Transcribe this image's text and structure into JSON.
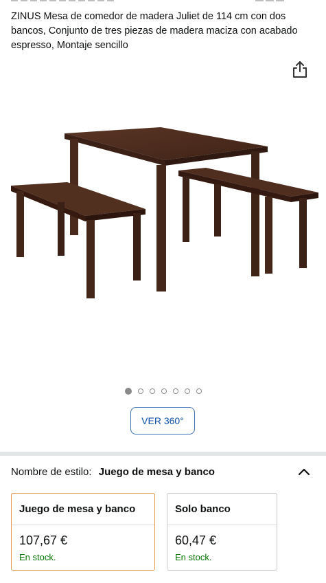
{
  "product": {
    "title": "ZINUS Mesa de comedor de madera Juliet de 114 cm con dos bancos, Conjunto de tres piezas de madera maciza con acabado espresso, Montaje sencillo"
  },
  "icons": {
    "share": "share-icon",
    "chevron": "chevron-up-icon"
  },
  "gallery": {
    "image_count": 7,
    "active_index": 0,
    "view360_label": "VER 360°"
  },
  "style_selector": {
    "label": "Nombre de estilo:",
    "selected_value": "Juego de mesa y banco",
    "options": [
      {
        "name": "Juego de mesa y banco",
        "price": "107,67 €",
        "stock": "En stock.",
        "selected": true
      },
      {
        "name": "Solo banco",
        "price": "60,47 €",
        "stock": "En stock.",
        "selected": false
      }
    ]
  },
  "colors": {
    "stock_green": "#007600",
    "link_blue": "#0b4fa8",
    "selected_border": "#e79a4c",
    "wood": "#4a2a1c"
  }
}
